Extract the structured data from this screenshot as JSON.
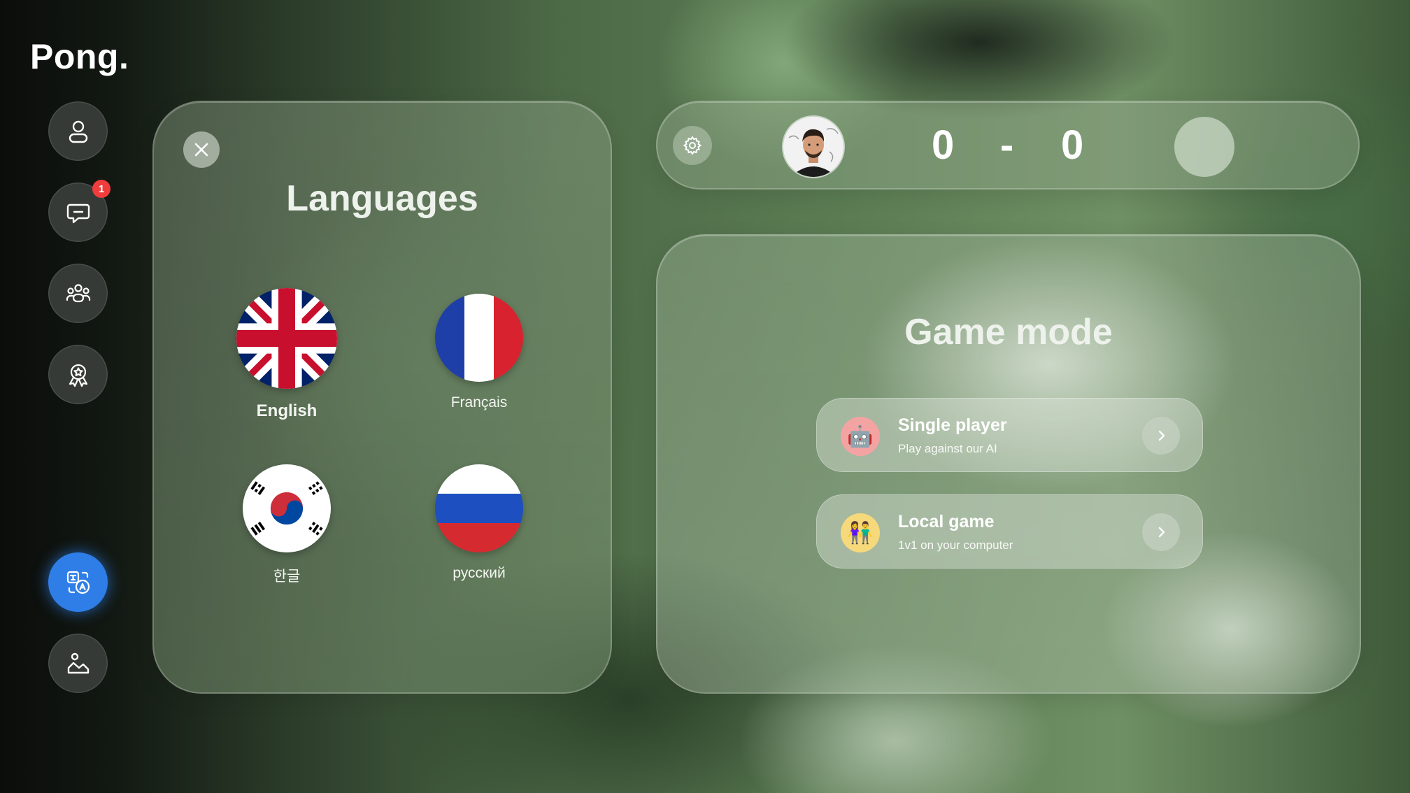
{
  "app": {
    "logo": "Pong."
  },
  "sidebar": {
    "items": [
      {
        "name": "profile",
        "icon": "user-icon"
      },
      {
        "name": "chat",
        "icon": "chat-icon",
        "badge": "1"
      },
      {
        "name": "friends",
        "icon": "users-icon"
      },
      {
        "name": "achievements",
        "icon": "award-icon"
      },
      {
        "name": "language",
        "icon": "translate-icon",
        "active": true
      },
      {
        "name": "theme",
        "icon": "landscape-icon"
      }
    ],
    "accent_color": "#2f7ee8",
    "badge_color": "#ef3d3d"
  },
  "languages_panel": {
    "title": "Languages",
    "items": [
      {
        "label": "English",
        "flag": "uk-flag-icon",
        "selected": true
      },
      {
        "label": "Français",
        "flag": "france-flag-icon"
      },
      {
        "label": "한글",
        "flag": "korea-flag-icon"
      },
      {
        "label": "русский",
        "flag": "russia-flag-icon"
      }
    ]
  },
  "scoreboard": {
    "score_left": "0",
    "separator": "-",
    "score_right": "0"
  },
  "game_mode": {
    "title": "Game mode",
    "modes": [
      {
        "title": "Single player",
        "subtitle": "Play against our AI",
        "icon": "robot-icon"
      },
      {
        "title": "Local game",
        "subtitle": "1v1 on your computer",
        "icon": "people-icon"
      }
    ]
  }
}
